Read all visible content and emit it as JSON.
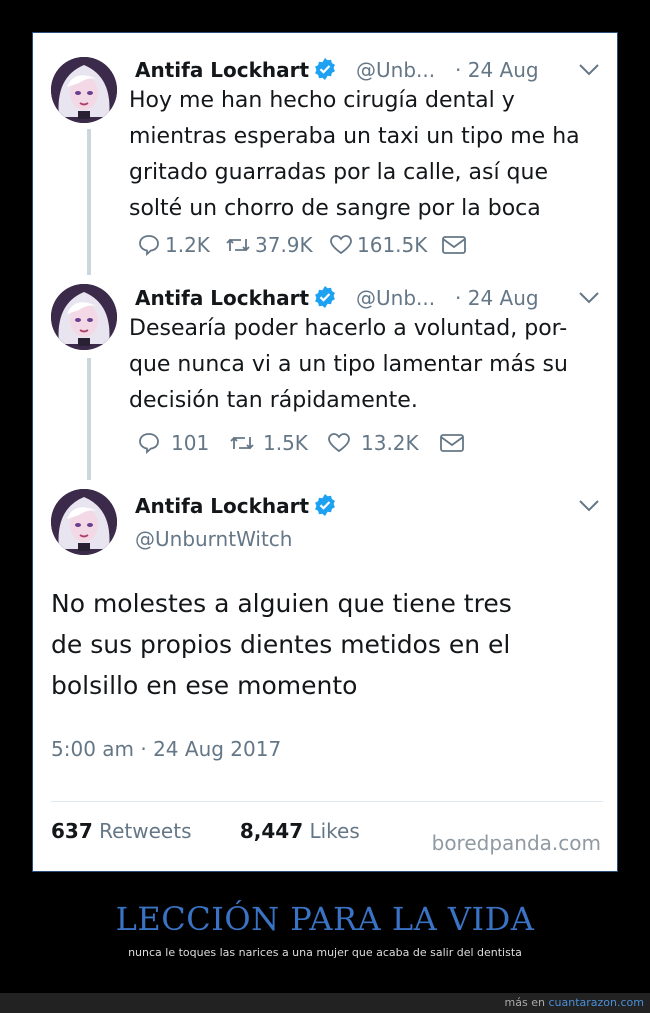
{
  "tweets": [
    {
      "author_name": "Antifa Lockhart",
      "handle": "@Unb...",
      "date": "· 24 Aug",
      "lines": [
        "Hoy me han hecho cirugía dental y",
        "mientras esperaba un taxi un tipo me ha",
        "gritado guarradas por la calle, así que",
        "solté un chorro de sangre por la boca"
      ],
      "replies": "1.2K",
      "retweets": "37.9K",
      "likes": "161.5K"
    },
    {
      "author_name": "Antifa Lockhart",
      "handle": "@Unb...",
      "date": "· 24 Aug",
      "lines": [
        "Desearía poder hacerlo a voluntad, por-",
        "que nunca vi a un tipo lamentar más su",
        "decisión tan rápidamente."
      ],
      "replies": "101",
      "retweets": "1.5K",
      "likes": "13.2K"
    }
  ],
  "main_tweet": {
    "author_name": "Antifa Lockhart",
    "handle": "@UnburntWitch",
    "lines": [
      "No molestes a alguien que tiene tres",
      "de sus propios dientes metidos en el",
      "bolsillo en ese momento"
    ],
    "timestamp": "5:00 am · 24 Aug 2017",
    "retweet_count": "637",
    "retweet_label": "Retweets",
    "like_count": "8,447",
    "like_label": "Likes"
  },
  "watermark": "boredpanda.com",
  "caption": {
    "title": "LECCIÓN PARA LA VIDA",
    "subtitle": "nunca le toques las narices a una mujer que acaba de salir del dentista"
  },
  "footer": {
    "prefix": "más en",
    "site": "cuantarazon.com"
  },
  "colors": {
    "verified": "#1da1f2",
    "caption": "#3a73c4",
    "text": "#14171a",
    "muted": "#657786"
  }
}
